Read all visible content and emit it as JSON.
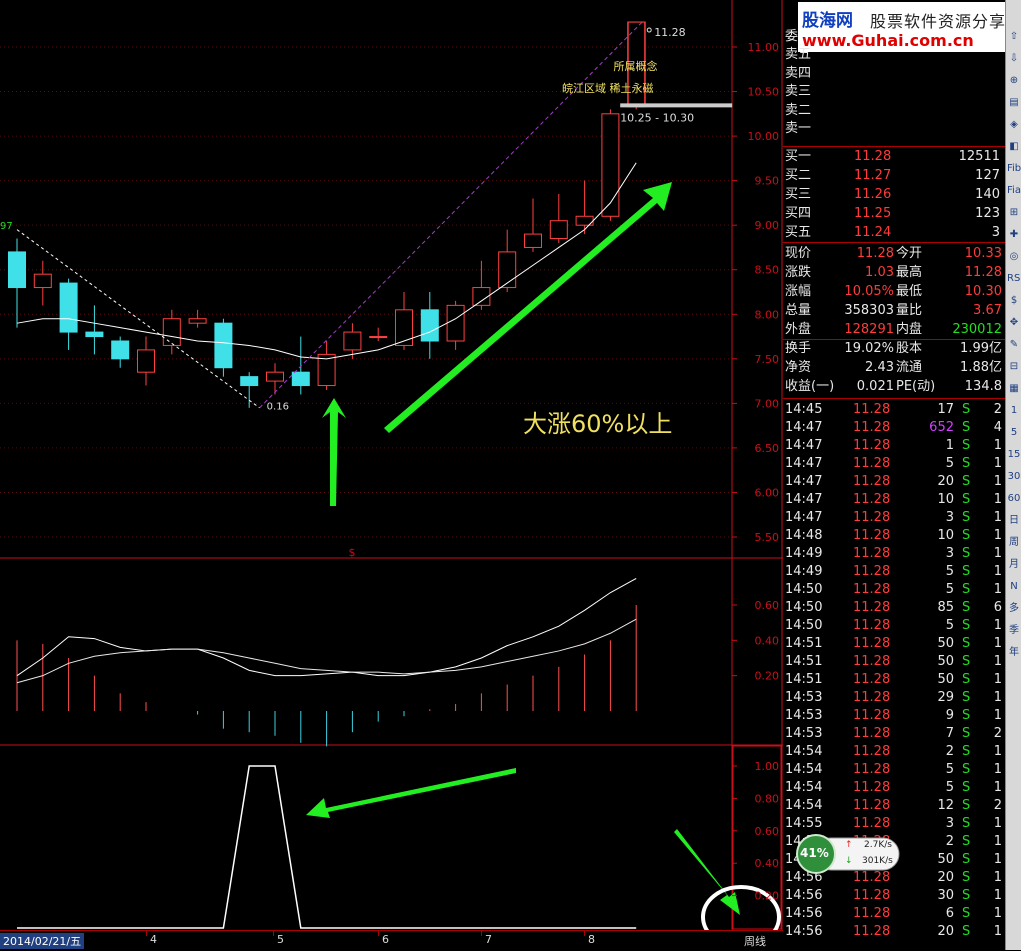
{
  "watermark": {
    "brand_cn": "股海网",
    "brand_slogan": "股票软件资源分享",
    "site": "www.Guhai.com.cn"
  },
  "chart_data": {
    "type": "candlestick",
    "period": "周线",
    "date_label": "2014/02/21/五",
    "month_ticks": [
      "4",
      "5",
      "6",
      "7",
      "8"
    ],
    "price_axis": [
      "11.00",
      "10.50",
      "10.00",
      "9.50",
      "9.00",
      "8.50",
      "8.00",
      "7.50",
      "7.00",
      "6.50",
      "6.00",
      "5.50"
    ],
    "ylim": [
      5.3,
      11.5
    ],
    "last_price_label": "11.28",
    "prev_high_label": "10.25 - 10.30",
    "low_label": "0.16",
    "left_label": "97",
    "concept_label": "所属概念",
    "concept_tags": "皖江区域 稀土永磁",
    "annotation": "大涨60%以上",
    "marker_symbol": "$",
    "candles": [
      {
        "o": 8.7,
        "c": 8.3,
        "h": 8.85,
        "l": 7.85
      },
      {
        "o": 8.3,
        "c": 8.45,
        "h": 8.6,
        "l": 8.1
      },
      {
        "o": 8.35,
        "c": 7.8,
        "h": 8.4,
        "l": 7.6
      },
      {
        "o": 7.8,
        "c": 7.75,
        "h": 8.1,
        "l": 7.55
      },
      {
        "o": 7.7,
        "c": 7.5,
        "h": 7.75,
        "l": 7.4
      },
      {
        "o": 7.35,
        "c": 7.6,
        "h": 7.75,
        "l": 7.2
      },
      {
        "o": 7.65,
        "c": 7.95,
        "h": 8.05,
        "l": 7.55
      },
      {
        "o": 7.9,
        "c": 7.95,
        "h": 8.05,
        "l": 7.85
      },
      {
        "o": 7.9,
        "c": 7.4,
        "h": 7.95,
        "l": 7.3
      },
      {
        "o": 7.3,
        "c": 7.2,
        "h": 7.35,
        "l": 6.95
      },
      {
        "o": 7.25,
        "c": 7.35,
        "h": 7.45,
        "l": 7.1
      },
      {
        "o": 7.35,
        "c": 7.2,
        "h": 7.75,
        "l": 7.1
      },
      {
        "o": 7.2,
        "c": 7.55,
        "h": 7.7,
        "l": 7.15
      },
      {
        "o": 7.6,
        "c": 7.8,
        "h": 7.9,
        "l": 7.5
      },
      {
        "o": 7.75,
        "c": 7.75,
        "h": 7.85,
        "l": 7.7
      },
      {
        "o": 7.65,
        "c": 8.05,
        "h": 8.25,
        "l": 7.6
      },
      {
        "o": 8.05,
        "c": 7.7,
        "h": 8.25,
        "l": 7.5
      },
      {
        "o": 7.7,
        "c": 8.1,
        "h": 8.15,
        "l": 7.6
      },
      {
        "o": 8.1,
        "c": 8.3,
        "h": 8.6,
        "l": 8.05
      },
      {
        "o": 8.3,
        "c": 8.7,
        "h": 8.95,
        "l": 8.25
      },
      {
        "o": 8.75,
        "c": 8.9,
        "h": 9.3,
        "l": 8.7
      },
      {
        "o": 8.85,
        "c": 9.05,
        "h": 9.35,
        "l": 8.8
      },
      {
        "o": 9.0,
        "c": 9.1,
        "h": 9.5,
        "l": 8.9
      },
      {
        "o": 9.1,
        "c": 10.25,
        "h": 10.3,
        "l": 9.05
      },
      {
        "o": 10.33,
        "c": 11.28,
        "h": 11.28,
        "l": 10.3
      }
    ],
    "ma": [
      7.9,
      7.95,
      7.95,
      7.9,
      7.85,
      7.8,
      7.75,
      7.7,
      7.68,
      7.65,
      7.6,
      7.52,
      7.5,
      7.55,
      7.6,
      7.7,
      7.8,
      7.95,
      8.15,
      8.35,
      8.55,
      8.75,
      8.95,
      9.25,
      9.7
    ],
    "macd_axis": [
      "0.60",
      "0.40",
      "0.20"
    ],
    "macd_dif": [
      0.2,
      0.3,
      0.42,
      0.41,
      0.36,
      0.34,
      0.35,
      0.35,
      0.3,
      0.23,
      0.2,
      0.2,
      0.21,
      0.22,
      0.2,
      0.2,
      0.22,
      0.25,
      0.3,
      0.37,
      0.42,
      0.48,
      0.57,
      0.67,
      0.75
    ],
    "macd_dea": [
      0.16,
      0.2,
      0.27,
      0.31,
      0.33,
      0.34,
      0.35,
      0.35,
      0.33,
      0.3,
      0.27,
      0.24,
      0.23,
      0.22,
      0.22,
      0.21,
      0.22,
      0.23,
      0.25,
      0.28,
      0.31,
      0.34,
      0.38,
      0.44,
      0.52
    ],
    "macd_bars": [
      0.4,
      0.38,
      0.3,
      0.2,
      0.1,
      0.05,
      0.0,
      -0.02,
      -0.1,
      -0.12,
      -0.14,
      -0.18,
      -0.2,
      -0.12,
      -0.06,
      -0.03,
      0.01,
      0.04,
      0.1,
      0.15,
      0.2,
      0.25,
      0.32,
      0.4,
      0.6
    ],
    "ind3_axis": [
      "1.00",
      "0.80",
      "0.60",
      "0.40",
      "0.20"
    ],
    "ind3_values": [
      0,
      0,
      0,
      0,
      0,
      0,
      0,
      0,
      0,
      1,
      1,
      0,
      0,
      0,
      0,
      0,
      0,
      0,
      0,
      0,
      0,
      0,
      0,
      0,
      0
    ]
  },
  "orderbook": {
    "header_label": "委",
    "asks": [
      {
        "label": "卖五",
        "price": "",
        "vol": ""
      },
      {
        "label": "卖四",
        "price": "",
        "vol": ""
      },
      {
        "label": "卖三",
        "price": "",
        "vol": ""
      },
      {
        "label": "卖二",
        "price": "",
        "vol": ""
      },
      {
        "label": "卖一",
        "price": "",
        "vol": ""
      }
    ],
    "bids": [
      {
        "label": "买一",
        "price": "11.28",
        "vol": "12511"
      },
      {
        "label": "买二",
        "price": "11.27",
        "vol": "127"
      },
      {
        "label": "买三",
        "price": "11.26",
        "vol": "140"
      },
      {
        "label": "买四",
        "price": "11.25",
        "vol": "123"
      },
      {
        "label": "买五",
        "price": "11.24",
        "vol": "3"
      }
    ]
  },
  "quote": [
    {
      "l1": "现价",
      "v1": "11.28",
      "l2": "今开",
      "v2": "10.33"
    },
    {
      "l1": "涨跌",
      "v1": "1.03",
      "l2": "最高",
      "v2": "11.28"
    },
    {
      "l1": "涨幅",
      "v1": "10.05%",
      "l2": "最低",
      "v2": "10.30"
    },
    {
      "l1": "总量",
      "v1": "358303",
      "l2": "量比",
      "v2": "3.67"
    },
    {
      "l1": "外盘",
      "v1": "128291",
      "l2": "内盘",
      "v2": "230012"
    },
    {
      "l1": "换手",
      "v1": "19.02%",
      "l2": "股本",
      "v2": "1.99亿"
    },
    {
      "l1": "净资",
      "v1": "2.43",
      "l2": "流通",
      "v2": "1.88亿"
    },
    {
      "l1": "收益(一)",
      "v1": "0.021",
      "l2": "PE(动)",
      "v2": "134.8"
    }
  ],
  "ticks": [
    {
      "t": "14:45",
      "p": "11.28",
      "v": "17",
      "s": "S",
      "n": "2"
    },
    {
      "t": "14:47",
      "p": "11.28",
      "v": "652",
      "s": "S",
      "n": "4",
      "big": true
    },
    {
      "t": "14:47",
      "p": "11.28",
      "v": "1",
      "s": "S",
      "n": "1"
    },
    {
      "t": "14:47",
      "p": "11.28",
      "v": "5",
      "s": "S",
      "n": "1"
    },
    {
      "t": "14:47",
      "p": "11.28",
      "v": "20",
      "s": "S",
      "n": "1"
    },
    {
      "t": "14:47",
      "p": "11.28",
      "v": "10",
      "s": "S",
      "n": "1"
    },
    {
      "t": "14:47",
      "p": "11.28",
      "v": "3",
      "s": "S",
      "n": "1"
    },
    {
      "t": "14:48",
      "p": "11.28",
      "v": "10",
      "s": "S",
      "n": "1"
    },
    {
      "t": "14:49",
      "p": "11.28",
      "v": "3",
      "s": "S",
      "n": "1"
    },
    {
      "t": "14:49",
      "p": "11.28",
      "v": "5",
      "s": "S",
      "n": "1"
    },
    {
      "t": "14:50",
      "p": "11.28",
      "v": "5",
      "s": "S",
      "n": "1"
    },
    {
      "t": "14:50",
      "p": "11.28",
      "v": "85",
      "s": "S",
      "n": "6"
    },
    {
      "t": "14:50",
      "p": "11.28",
      "v": "5",
      "s": "S",
      "n": "1"
    },
    {
      "t": "14:51",
      "p": "11.28",
      "v": "50",
      "s": "S",
      "n": "1"
    },
    {
      "t": "14:51",
      "p": "11.28",
      "v": "50",
      "s": "S",
      "n": "1"
    },
    {
      "t": "14:51",
      "p": "11.28",
      "v": "50",
      "s": "S",
      "n": "1"
    },
    {
      "t": "14:53",
      "p": "11.28",
      "v": "29",
      "s": "S",
      "n": "1"
    },
    {
      "t": "14:53",
      "p": "11.28",
      "v": "9",
      "s": "S",
      "n": "1"
    },
    {
      "t": "14:53",
      "p": "11.28",
      "v": "7",
      "s": "S",
      "n": "2"
    },
    {
      "t": "14:54",
      "p": "11.28",
      "v": "2",
      "s": "S",
      "n": "1"
    },
    {
      "t": "14:54",
      "p": "11.28",
      "v": "5",
      "s": "S",
      "n": "1"
    },
    {
      "t": "14:54",
      "p": "11.28",
      "v": "5",
      "s": "S",
      "n": "1"
    },
    {
      "t": "14:54",
      "p": "11.28",
      "v": "12",
      "s": "S",
      "n": "2"
    },
    {
      "t": "14:55",
      "p": "11.28",
      "v": "3",
      "s": "S",
      "n": "1"
    },
    {
      "t": "14:55",
      "p": "11.28",
      "v": "2",
      "s": "S",
      "n": "1"
    },
    {
      "t": "14:55",
      "p": "11.28",
      "v": "50",
      "s": "S",
      "n": "1"
    },
    {
      "t": "14:56",
      "p": "11.28",
      "v": "20",
      "s": "S",
      "n": "1"
    },
    {
      "t": "14:56",
      "p": "11.28",
      "v": "30",
      "s": "S",
      "n": "1"
    },
    {
      "t": "14:56",
      "p": "11.28",
      "v": "6",
      "s": "S",
      "n": "1"
    },
    {
      "t": "14:56",
      "p": "11.28",
      "v": "20",
      "s": "S",
      "n": "1"
    }
  ],
  "speed_widget": {
    "percent": "41%",
    "up": "2.7K/s",
    "down": "301K/s"
  },
  "side_icons": [
    "⇧",
    "⇩",
    "⊕",
    "▤",
    "◈",
    "◧",
    "Fib",
    "Fia",
    "⊞",
    "✚",
    "◎",
    "RSI",
    "$",
    "✥",
    "✎",
    "⊟",
    "▦",
    "1",
    "5",
    "15",
    "30",
    "60",
    "日",
    "周",
    "月",
    "N",
    "多",
    "季",
    "年"
  ]
}
